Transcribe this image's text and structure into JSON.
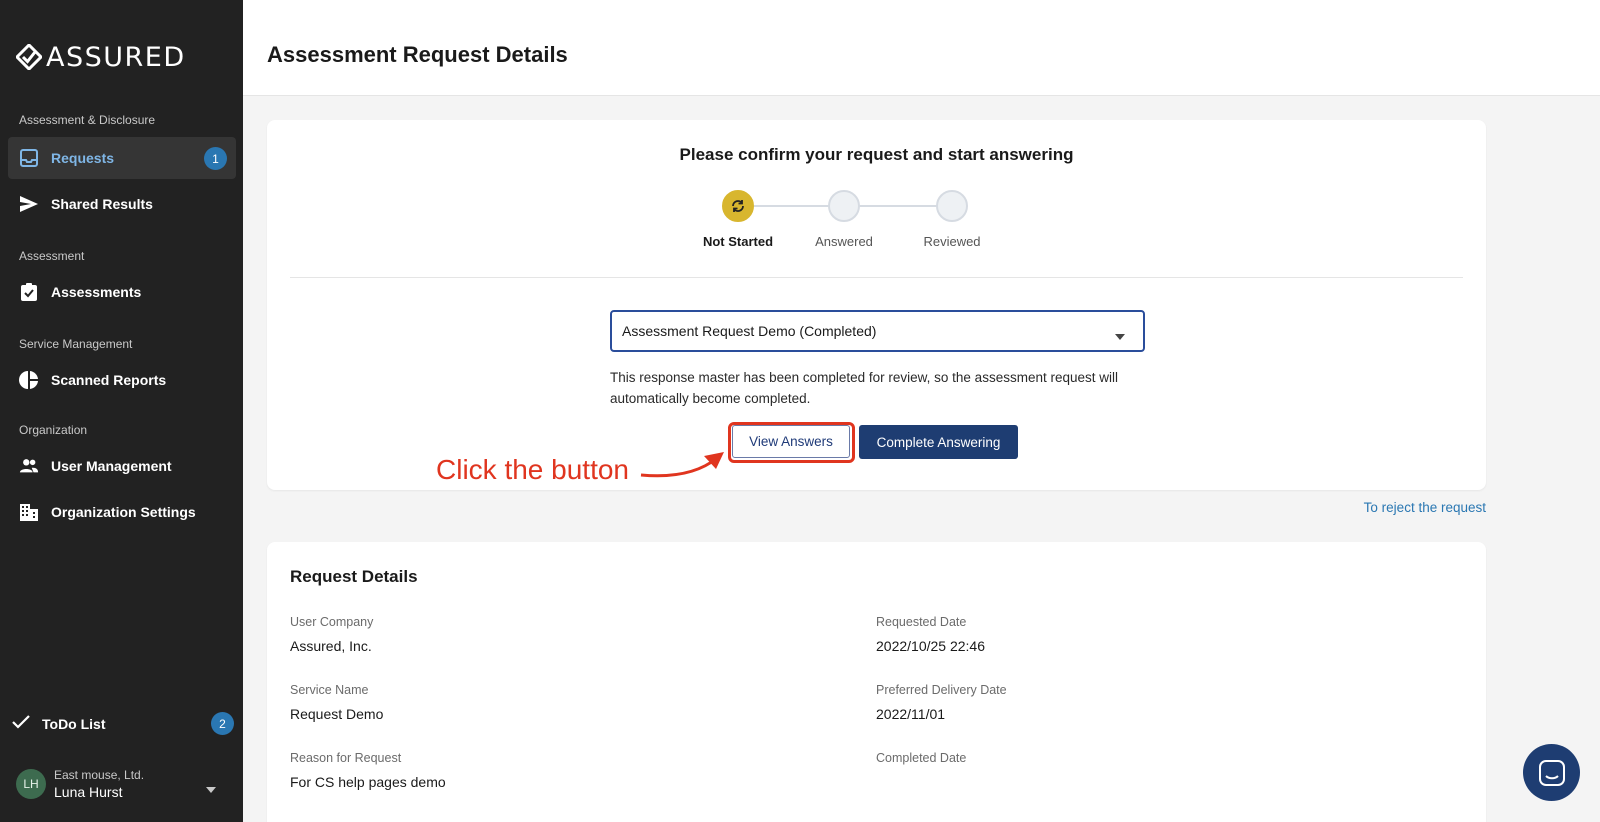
{
  "app": {
    "logo_text": "ASSURED"
  },
  "sidebar": {
    "sections": [
      {
        "label": "Assessment & Disclosure"
      },
      {
        "label": "Assessment"
      },
      {
        "label": "Service Management"
      },
      {
        "label": "Organization"
      }
    ],
    "items": [
      {
        "label": "Requests",
        "icon": "inbox-icon",
        "badge": "1",
        "active": true
      },
      {
        "label": "Shared Results",
        "icon": "send-icon"
      },
      {
        "label": "Assessments",
        "icon": "clipboard-check-icon"
      },
      {
        "label": "Scanned Reports",
        "icon": "pie-chart-icon"
      },
      {
        "label": "User Management",
        "icon": "people-icon"
      },
      {
        "label": "Organization Settings",
        "icon": "building-icon"
      }
    ],
    "todo": {
      "label": "ToDo List",
      "badge": "2"
    },
    "user": {
      "initials": "LH",
      "company": "East mouse, Ltd.",
      "name": "Luna Hurst"
    }
  },
  "header": {
    "title": "Assessment Request Details"
  },
  "confirm": {
    "title": "Please confirm your request and start answering",
    "steps": [
      {
        "label": "Not Started",
        "state": "current"
      },
      {
        "label": "Answered",
        "state": "pending"
      },
      {
        "label": "Reviewed",
        "state": "pending"
      }
    ],
    "select_value": "Assessment Request Demo (Completed)",
    "info": "This response master has been completed for review, so the assessment request will automatically become completed.",
    "view_button": "View Answers",
    "complete_button": "Complete Answering",
    "reject_link": "To reject the request"
  },
  "annotation": {
    "text": "Click the button",
    "color": "#e0351f"
  },
  "details": {
    "title": "Request Details",
    "fields": [
      {
        "label": "User Company",
        "value": "Assured, Inc."
      },
      {
        "label": "Requested Date",
        "value": "2022/10/25 22:46"
      },
      {
        "label": "Service Name",
        "value": "Request Demo"
      },
      {
        "label": "Preferred Delivery Date",
        "value": "2022/11/01"
      },
      {
        "label": "Reason for Request",
        "value": "For CS help pages demo"
      },
      {
        "label": "Completed Date",
        "value": ""
      }
    ]
  },
  "colors": {
    "accent": "#1e3d72",
    "link": "#2a77b2",
    "step_current": "#d8b62e",
    "sidebar_bg": "#222222"
  }
}
